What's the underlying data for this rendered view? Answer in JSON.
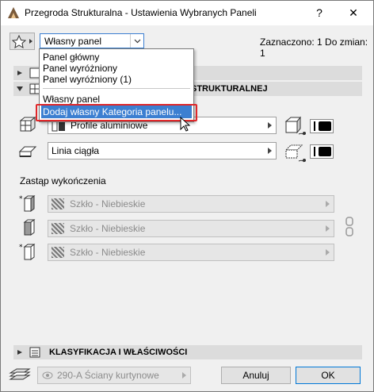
{
  "window": {
    "title": "Przegroda Strukturalna - Ustawienia Wybranych Paneli",
    "help": "?",
    "close": "✕"
  },
  "toolbar": {
    "panel_select_value": "Własny panel",
    "selection_info": "Zaznaczono: 1 Do zmian: 1"
  },
  "panel_menu": {
    "items": [
      "Panel główny",
      "Panel wyróżniony",
      "Panel wyróżniony (1)",
      "Własny panel",
      "Dodaj własny Kategoria panelu..."
    ]
  },
  "section_header": {
    "label": "STRUKTURALNEJ"
  },
  "profile_row": {
    "value": "Profile aluminiowe"
  },
  "line_row": {
    "value": "Linia ciągła"
  },
  "finishes": {
    "label": "Zastąp wykończenia",
    "rows": [
      "Szkło - Niebieskie",
      "Szkło - Niebieskie",
      "Szkło - Niebieskie"
    ]
  },
  "classification": {
    "label": "KLASYFIKACJA I WŁAŚCIWOŚCI"
  },
  "footer": {
    "layer_value": "290-A Ściany kurtynowe",
    "cancel_label": "Anuluj",
    "ok_label": "OK"
  },
  "colors": {
    "highlight": "#3c7fd1",
    "callout": "#e0272a"
  }
}
